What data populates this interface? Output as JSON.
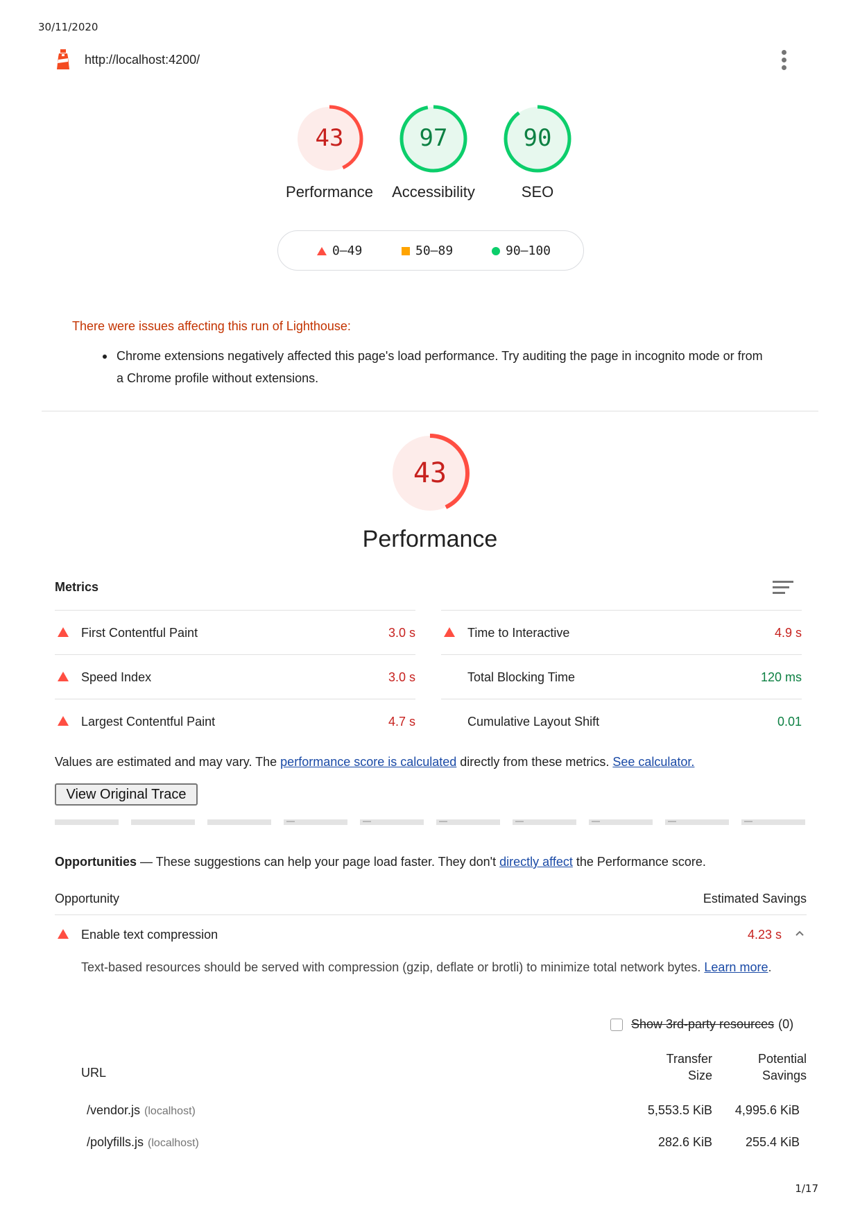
{
  "print": {
    "date": "30/11/2020",
    "page": "1/17"
  },
  "header": {
    "url": "http://localhost:4200/"
  },
  "gauges": [
    {
      "label": "Performance",
      "score": "43",
      "color": "#ff4e42",
      "fill": "#fdecea"
    },
    {
      "label": "Accessibility",
      "score": "97",
      "color": "#0cce6b",
      "fill": "#e7f8ee"
    },
    {
      "label": "SEO",
      "score": "90",
      "color": "#0cce6b",
      "fill": "#e7f8ee"
    }
  ],
  "legend": {
    "fail": "0–49",
    "average": "50–89",
    "pass": "90–100"
  },
  "warnings": {
    "title": "There were issues affecting this run of Lighthouse:",
    "items": [
      "Chrome extensions negatively affected this page's load performance. Try auditing the page in incognito mode or from a Chrome profile without extensions."
    ]
  },
  "performance": {
    "score": "43",
    "title": "Performance",
    "metrics_label": "Metrics",
    "metrics_left": [
      {
        "name": "First Contentful Paint",
        "value": "3.0 s",
        "status": "fail"
      },
      {
        "name": "Speed Index",
        "value": "3.0 s",
        "status": "fail"
      },
      {
        "name": "Largest Contentful Paint",
        "value": "4.7 s",
        "status": "fail"
      }
    ],
    "metrics_right": [
      {
        "name": "Time to Interactive",
        "value": "4.9 s",
        "status": "fail"
      },
      {
        "name": "Total Blocking Time",
        "value": "120 ms",
        "status": "pass"
      },
      {
        "name": "Cumulative Layout Shift",
        "value": "0.01",
        "status": "pass"
      }
    ],
    "note_prefix": "Values are estimated and may vary. The ",
    "note_link1": "performance score is calculated",
    "note_mid": " directly from these metrics. ",
    "note_link2": "See calculator.",
    "trace_button": "View Original Trace"
  },
  "opportunities": {
    "title": "Opportunities",
    "dash": " — ",
    "desc_prefix": "These suggestions can help your page load faster. They don't ",
    "desc_link": "directly affect",
    "desc_suffix": " the Performance score.",
    "col_opportunity": "Opportunity",
    "col_savings": "Estimated Savings",
    "items": [
      {
        "name": "Enable text compression",
        "value": "4.23 s",
        "desc": "Text-based resources should be served with compression (gzip, deflate or brotli) to minimize total network bytes. ",
        "learn_more": "Learn more",
        "third_party_label": "Show 3rd-party resources",
        "third_party_count": "(0)",
        "table": {
          "col_url": "URL",
          "col_transfer_1": "Transfer",
          "col_transfer_2": "Size",
          "col_savings_1": "Potential",
          "col_savings_2": "Savings",
          "rows": [
            {
              "url": "/vendor.js",
              "host": "(localhost)",
              "transfer": "5,553.5 KiB",
              "savings": "4,995.6 KiB"
            },
            {
              "url": "/polyfills.js",
              "host": "(localhost)",
              "transfer": "282.6 KiB",
              "savings": "255.4 KiB"
            }
          ]
        }
      }
    ]
  }
}
